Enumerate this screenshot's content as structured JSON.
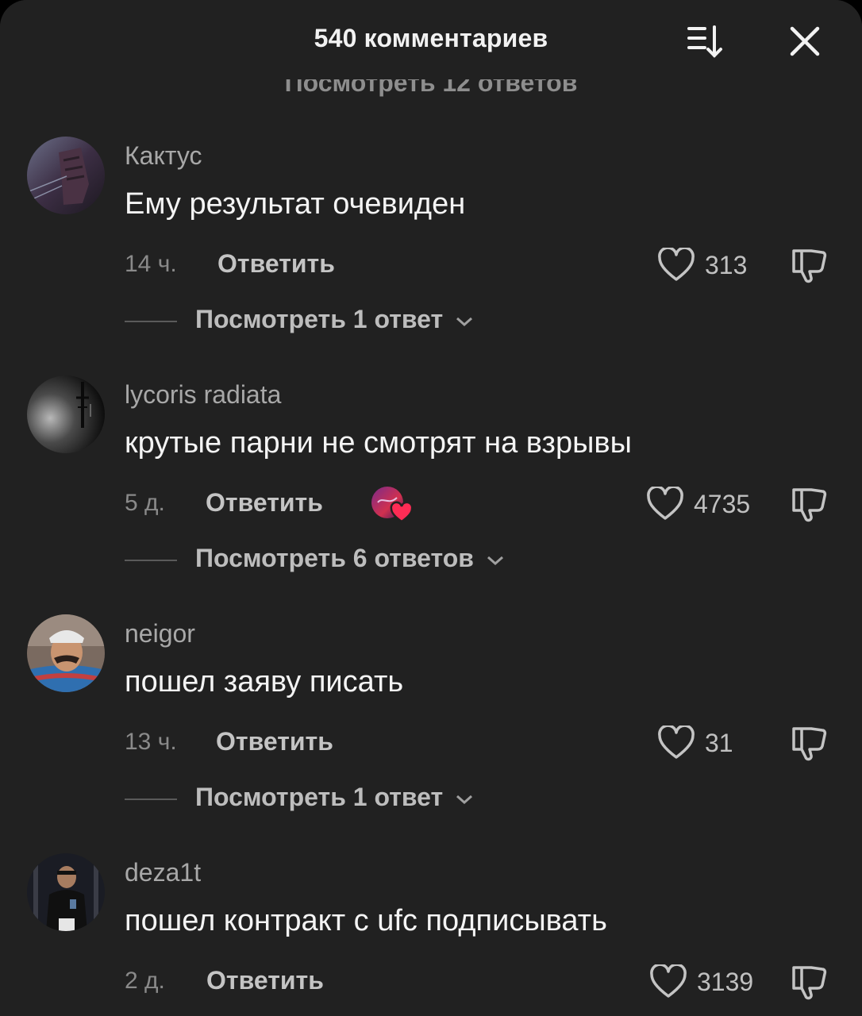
{
  "header": {
    "title": "540 комментариев",
    "hidden_peek": "Посмотреть 12 ответов"
  },
  "comments": [
    {
      "username": "Кактус",
      "text": "Ему результат очевиден",
      "time": "14 ч.",
      "reply_label": "Ответить",
      "likes": "313",
      "view_replies": "Посмотреть 1 ответ",
      "creator_liked": false
    },
    {
      "username": "lycoris radiata",
      "text": "крутые парни не смотрят на взрывы",
      "time": "5 д.",
      "reply_label": "Ответить",
      "likes": "4735",
      "view_replies": "Посмотреть 6 ответов",
      "creator_liked": true
    },
    {
      "username": "neigor",
      "text": "пошел заяву писать",
      "time": "13 ч.",
      "reply_label": "Ответить",
      "likes": "31",
      "view_replies": "Посмотреть 1 ответ",
      "creator_liked": false
    },
    {
      "username": "deza1t",
      "text": "пошел контракт с ufc подписывать",
      "time": "2 д.",
      "reply_label": "Ответить",
      "likes": "3139",
      "view_replies": "",
      "creator_liked": false
    }
  ],
  "icons": {
    "sort": "sort-icon",
    "close": "close-icon",
    "like": "heart-outline-icon",
    "dislike": "thumbs-down-icon"
  },
  "colors": {
    "background": "#212121",
    "creator_heart": "#fe2c55"
  }
}
